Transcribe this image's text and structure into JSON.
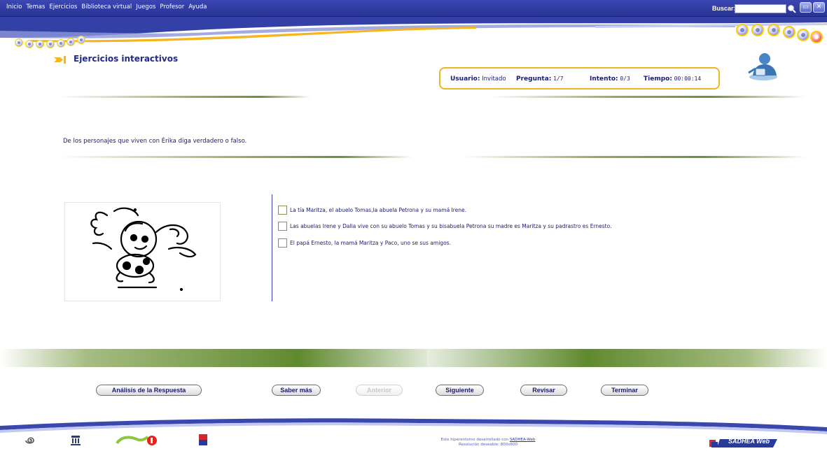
{
  "menu": {
    "items": [
      "Inicio",
      "Temas",
      "Ejercicios",
      "Biblioteca virtual",
      "Juegos",
      "Profesor",
      "Ayuda"
    ],
    "search_label": "Buscar:",
    "search_value": ""
  },
  "page": {
    "title": "Ejercicios interactivos"
  },
  "status": {
    "user_label": "Usuario:",
    "user_value": "Invitado",
    "question_label": "Pregunta:",
    "question_value": "1/7",
    "attempt_label": "Intento:",
    "attempt_value": "0/3",
    "time_label": "Tiempo:",
    "time_value": "00:00:14"
  },
  "exercise": {
    "question": "De los personajes que viven con Érika diga verdadero o falso.",
    "options": [
      "La tía Maritza, el abuelo Tomas,la abuela Petrona y su mamá Irene.",
      "Las abuelas Irene y Dalia vive con su abuelo Tomas y su bisabuela Petrona su madre es Maritza y su padrastro es Ernesto.",
      "El papá Ernesto, la mamá Maritza y Paco, uno se sus amigos."
    ]
  },
  "buttons": {
    "analysis": "Análisis de la Respuesta",
    "more": "Saber más",
    "previous": "Anterior",
    "next": "Siguiente",
    "review": "Revisar",
    "finish": "Terminar"
  },
  "footer": {
    "credit_prefix": "Este hiperentorno desarrollado con",
    "credit_link": "SADHEA-Web",
    "resolution": "Resolución deseable: 800x600",
    "brand": "SADHEA Web"
  },
  "colors": {
    "menubar": "#2a3494",
    "accent_gold": "#f0b322",
    "band_green": "#5f8a2e",
    "text_navy": "#1a1a6e"
  }
}
